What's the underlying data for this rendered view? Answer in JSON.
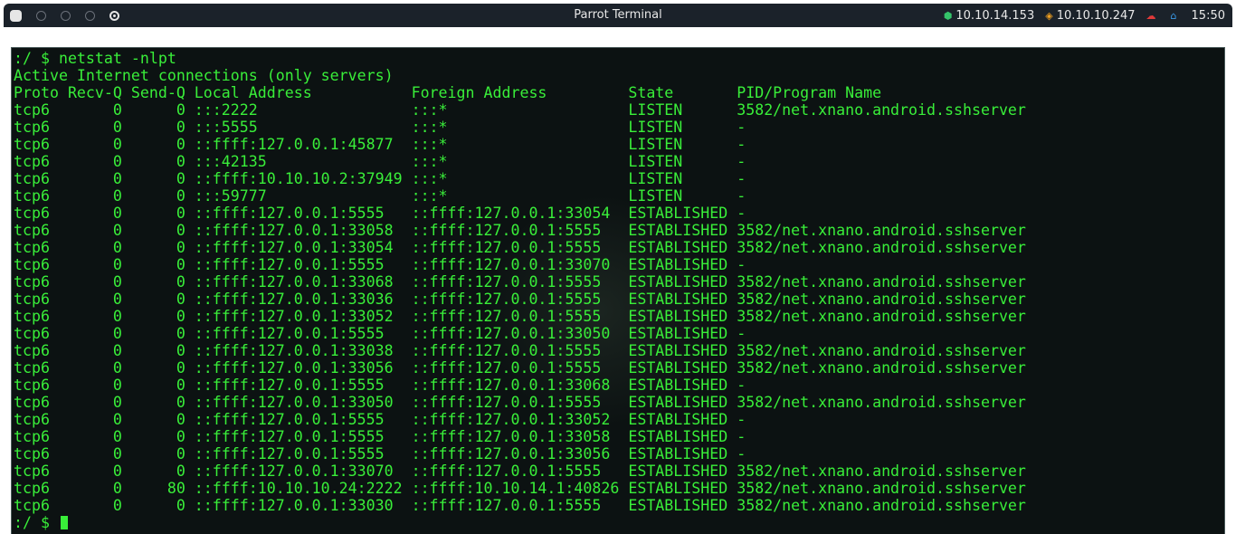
{
  "window": {
    "title": "Parrot Terminal"
  },
  "tray": {
    "vpn_ip": "10.10.14.153",
    "target_ip": "10.10.10.247",
    "clock": "15:50",
    "colors": {
      "vpn": "#35c46a",
      "target": "#f0a020",
      "cloud": "#e03a3a",
      "home": "#3a9ae8"
    }
  },
  "terminal": {
    "command_line": ":/ $ netstat -nlpt",
    "banner": "Active Internet connections (only servers)",
    "header": "Proto Recv-Q Send-Q Local Address           Foreign Address         State       PID/Program Name",
    "rows": [
      "tcp6       0      0 :::2222                 :::*                    LISTEN      3582/net.xnano.android.sshserver",
      "tcp6       0      0 :::5555                 :::*                    LISTEN      -",
      "tcp6       0      0 ::ffff:127.0.0.1:45877  :::*                    LISTEN      -",
      "tcp6       0      0 :::42135                :::*                    LISTEN      -",
      "tcp6       0      0 ::ffff:10.10.10.2:37949 :::*                    LISTEN      -",
      "tcp6       0      0 :::59777                :::*                    LISTEN      -",
      "tcp6       0      0 ::ffff:127.0.0.1:5555   ::ffff:127.0.0.1:33054  ESTABLISHED -",
      "tcp6       0      0 ::ffff:127.0.0.1:33058  ::ffff:127.0.0.1:5555   ESTABLISHED 3582/net.xnano.android.sshserver",
      "tcp6       0      0 ::ffff:127.0.0.1:33054  ::ffff:127.0.0.1:5555   ESTABLISHED 3582/net.xnano.android.sshserver",
      "tcp6       0      0 ::ffff:127.0.0.1:5555   ::ffff:127.0.0.1:33070  ESTABLISHED -",
      "tcp6       0      0 ::ffff:127.0.0.1:33068  ::ffff:127.0.0.1:5555   ESTABLISHED 3582/net.xnano.android.sshserver",
      "tcp6       0      0 ::ffff:127.0.0.1:33036  ::ffff:127.0.0.1:5555   ESTABLISHED 3582/net.xnano.android.sshserver",
      "tcp6       0      0 ::ffff:127.0.0.1:33052  ::ffff:127.0.0.1:5555   ESTABLISHED 3582/net.xnano.android.sshserver",
      "tcp6       0      0 ::ffff:127.0.0.1:5555   ::ffff:127.0.0.1:33050  ESTABLISHED -",
      "tcp6       0      0 ::ffff:127.0.0.1:33038  ::ffff:127.0.0.1:5555   ESTABLISHED 3582/net.xnano.android.sshserver",
      "tcp6       0      0 ::ffff:127.0.0.1:33056  ::ffff:127.0.0.1:5555   ESTABLISHED 3582/net.xnano.android.sshserver",
      "tcp6       0      0 ::ffff:127.0.0.1:5555   ::ffff:127.0.0.1:33068  ESTABLISHED -",
      "tcp6       0      0 ::ffff:127.0.0.1:33050  ::ffff:127.0.0.1:5555   ESTABLISHED 3582/net.xnano.android.sshserver",
      "tcp6       0      0 ::ffff:127.0.0.1:5555   ::ffff:127.0.0.1:33052  ESTABLISHED -",
      "tcp6       0      0 ::ffff:127.0.0.1:5555   ::ffff:127.0.0.1:33058  ESTABLISHED -",
      "tcp6       0      0 ::ffff:127.0.0.1:5555   ::ffff:127.0.0.1:33056  ESTABLISHED -",
      "tcp6       0      0 ::ffff:127.0.0.1:33070  ::ffff:127.0.0.1:5555   ESTABLISHED 3582/net.xnano.android.sshserver",
      "tcp6       0     80 ::ffff:10.10.10.24:2222 ::ffff:10.10.14.1:40826 ESTABLISHED 3582/net.xnano.android.sshserver",
      "tcp6       0      0 ::ffff:127.0.0.1:33030  ::ffff:127.0.0.1:5555   ESTABLISHED 3582/net.xnano.android.sshserver"
    ],
    "prompt": ":/ $ ",
    "text_color": "#39ee39",
    "background": "#0c1212"
  }
}
